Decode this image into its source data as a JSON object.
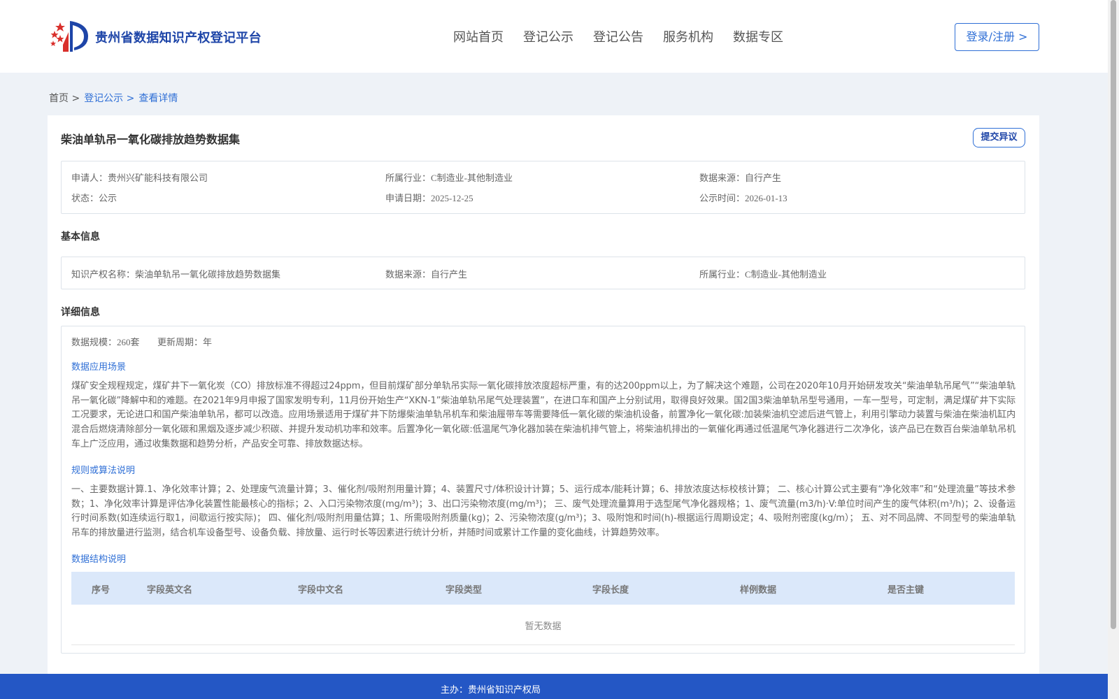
{
  "header": {
    "site_title": "贵州省数据知识产权登记平台",
    "nav": [
      "网站首页",
      "登记公示",
      "登记公告",
      "服务机构",
      "数据专区"
    ],
    "login_label": "登录/注册 >"
  },
  "breadcrumb": {
    "home": "首页 >",
    "section": "登记公示 >",
    "current": "查看详情"
  },
  "dataset": {
    "title": "柴油单轨吊一氧化碳排放趋势数据集",
    "objection_label": "提交异议",
    "summary": {
      "applicant_label": "申请人：",
      "applicant": "贵州兴矿能科技有限公司",
      "industry_label": "所属行业：",
      "industry": "C制造业-其他制造业",
      "source_label": "数据来源：",
      "source": "自行产生",
      "status_label": "状态：",
      "status": "公示",
      "apply_date_label": "申请日期：",
      "apply_date": "2025-12-25",
      "publicity_label": "公示时间：",
      "publicity_date": "2026-01-13"
    }
  },
  "basic": {
    "section_title": "基本信息",
    "ip_name_label": "知识产权名称：",
    "ip_name": "柴油单轨吊一氧化碳排放趋势数据集",
    "source_label": "数据来源：",
    "source": "自行产生",
    "industry_label": "所属行业：",
    "industry": "C制造业-其他制造业"
  },
  "detail": {
    "section_title": "详细信息",
    "scale_label": "数据规模：",
    "scale": "260套",
    "cycle_label": "更新周期：",
    "cycle": "年",
    "scenario_title": "数据应用场景",
    "scenario_text": "煤矿安全规程规定，煤矿井下一氧化炭（CO）排放标准不得超过24ppm，但目前煤矿部分单轨吊实际一氧化碳排放浓度超标严重，有的达200ppm以上，为了解决这个难题，公司在2020年10月开始研发攻关“柴油单轨吊尾气”“柴油单轨吊一氧化碳”降解中和的难题。在2021年9月申报了国家发明专利，11月份开始生产“XKN-1”柴油单轨吊尾气处理装置”，在进口车和国产上分别试用，取得良好效果。国2国3柴油单轨吊型号通用，一车一型号，可定制，满足煤矿井下实际工况要求，无论进口和国产柴油单轨吊，都可以改造。应用场景适用于煤矿井下防爆柴油单轨吊机车和柴油履带车等需要降低一氧化碳的柴油机设备，前置净化一氧化碳:加装柴油机空滤后进气管上，利用引擎动力装置与柴油在柴油机缸内混合后燃烧清除部分一氧化碳和黑烟及逐步减少积碳、并提升发动机功率和效率。后置净化一氧化碳:低温尾气净化器加装在柴油机排气管上，将柴油机排出的一氧催化再通过低温尾气净化器进行二次净化，该产品已在数百台柴油单轨吊机车上广泛应用，通过收集数据和趋势分析，产品安全可靠、排放数据达标。",
    "algorithm_title": "规则或算法说明",
    "algorithm_text": "一、主要数据计算.1、净化效率计算；2、处理废气流量计算；3、催化剂/吸附剂用量计算；4、装置尺寸/体积设计计算；5、运行成本/能耗计算；6、排放浓度达标校核计算； 二、核心计算公式主要有“净化效率”和“处理流量”等技术参数；1、净化效率计算是评估净化装置性能最核心的指标；2、入口污染物浓度(mg/m³)；3、出口污染物浓度(mg/m³)； 三、废气处理流量算用于选型尾气净化器规格；1、废气流量(m3/h)·V:单位时间产生的废气体积(m³/h)；2、设备运行时间系数(如连续运行取1，间歇运行按实际)； 四、催化剂/吸附剂用量估算；1、所需吸附剂质量(kg)；2、污染物浓度(g/m³)；3、吸附饱和时间(h)-根据运行周期设定；4、吸附剂密度(kg/m）； 五、对不同品牌、不同型号的柴油单轨吊车的排放量进行监测，结合机车设备型号、设备负载、排放量、运行时长等因素进行统计分析，并随时间或累计工作量的变化曲线，计算趋势效率。",
    "structure_title": "数据结构说明",
    "columns": [
      "序号",
      "字段英文名",
      "字段中文名",
      "字段类型",
      "字段长度",
      "样例数据",
      "是否主键"
    ],
    "empty_text": "暂无数据"
  },
  "footer": {
    "text": "主办：贵州省知识产权局"
  },
  "colors": {
    "brand_blue": "#1e45a8",
    "link_blue": "#2f6fd6",
    "footer_blue": "#2457c5",
    "page_bg": "#eef2f7",
    "table_head_bg": "#dbe8fa"
  }
}
